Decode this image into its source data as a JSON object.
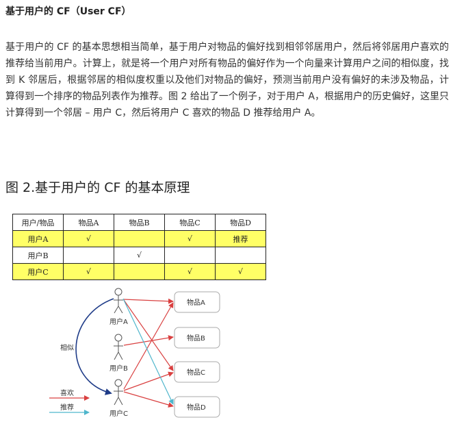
{
  "heading": "基于用户的 CF（User CF）",
  "paragraph": "基于用户的 CF 的基本思想相当简单，基于用户对物品的偏好找到相邻邻居用户，然后将邻居用户喜欢的推荐给当前用户。计算上，就是将一个用户对所有物品的偏好作为一个向量来计算用户之间的相似度，找到 K 邻居后，根据邻居的相似度权重以及他们对物品的偏好，预测当前用户没有偏好的未涉及物品，计算得到一个排序的物品列表作为推荐。图 2 给出了一个例子，对于用户 A，根据用户的历史偏好，这里只计算得到一个邻居 – 用户 C，然后将用户 C 喜欢的物品 D 推荐给用户 A。",
  "figure_title": "图 2.基于用户的 CF 的基本原理",
  "table": {
    "headers": [
      "用户/物品",
      "物品A",
      "物品B",
      "物品C",
      "物品D"
    ],
    "rows": [
      [
        "用户A",
        "√",
        "",
        "√",
        "推荐"
      ],
      [
        "用户B",
        "",
        "√",
        "",
        ""
      ],
      [
        "用户C",
        "√",
        "",
        "√",
        "√"
      ]
    ]
  },
  "diagram": {
    "users": [
      "用户A",
      "用户B",
      "用户C"
    ],
    "items": [
      "物品A",
      "物品B",
      "物品C",
      "物品D"
    ],
    "similarity_label": "相似",
    "legend": {
      "like": "喜欢",
      "recommend": "推荐"
    },
    "colors": {
      "like": "#d94040",
      "recommend": "#4fb6cc",
      "similar": "#1f3c88"
    }
  }
}
